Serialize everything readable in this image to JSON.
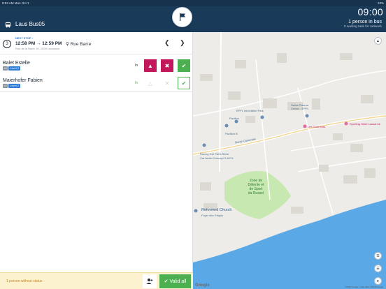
{
  "status_bar": {
    "left": "8:53 AM  Mon Oct 1",
    "right": "23%"
  },
  "header": {
    "bus_name": "Laus Bus05",
    "clock": "09:00",
    "people_count": "1 person in bus",
    "waiting_task": "0 waiting task for network",
    "flag_icon": "flag-icon",
    "bus_icon": "bus-icon"
  },
  "stop": {
    "number": "3",
    "label": "NEXT STOP :",
    "time": "12:58 PM → 12:59 PM",
    "place": "Rue Barre",
    "address": "Rue de la Barre 16, 1005 Lausanne",
    "prev_icon": "chevron-left-icon",
    "next_icon": "chevron-right-icon"
  },
  "passengers": [
    {
      "name": "Balet Estelle",
      "badge_a": "x2",
      "badge_b": "Level 2",
      "status": "In"
    },
    {
      "name": "Maierhofer Fabien",
      "badge_a": "x2",
      "badge_b": "Level 2",
      "status": "In"
    }
  ],
  "footer": {
    "status_text": "1 person without status",
    "valid_label": "Valid all"
  },
  "map": {
    "labels": {
      "epfl_park": "EPFL Innovation Park",
      "swiss_plasma": "Swiss Plasma",
      "center_epfl": "Center - EPFL",
      "pavillon": "Pavilion",
      "pavillon_b": "Pavillon B",
      "route": "Route Cantonale",
      "racing": "Racing Car Parts Store",
      "car_audio": "Car Audio Concept S.A.R.L",
      "zone": "Zone de\nDétente et\nde Sport\ndu Russel",
      "church": "Reformed Church",
      "church_sub": "Foyer des Pâquis",
      "les_gourmets": "Les Gourmets",
      "sporting": "Sporting Hotel Lausanne"
    },
    "google": "Google",
    "copyright": "©2018 Google - Map data ©2018 Google"
  },
  "colors": {
    "header_bg": "#1a3a5a",
    "alert": "#c2185b",
    "success": "#4caf50",
    "lake": "#5aa8e6",
    "park": "#c7e8b0"
  }
}
